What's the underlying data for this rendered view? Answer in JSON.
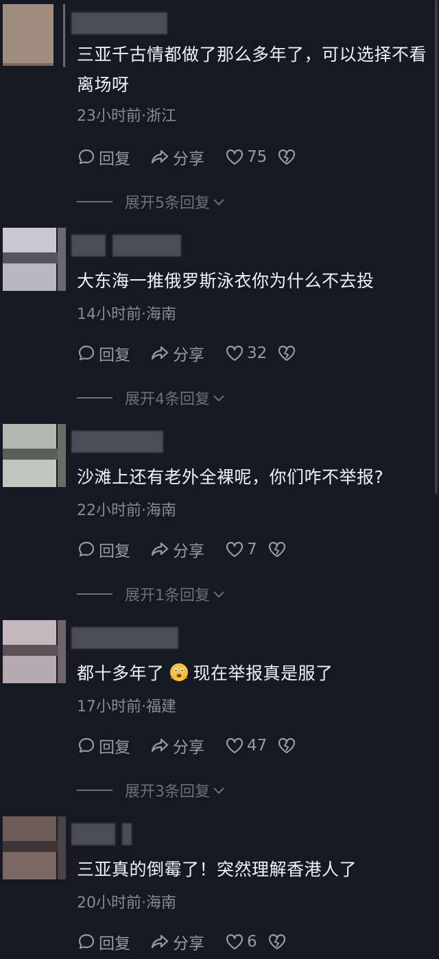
{
  "colors": {
    "background": "#161823",
    "text": "#f2f2f4",
    "meta": "#8a8b91",
    "action": "#9a9ba1",
    "expand": "#6f7077"
  },
  "actions": {
    "reply_label": "回复",
    "share_label": "分享"
  },
  "icons": [
    "comment-bubble-icon",
    "share-arrow-icon",
    "heart-icon",
    "broken-heart-icon",
    "chevron-down-icon",
    "scared-face-emoji"
  ],
  "comments": [
    {
      "text": "三亚千古情都做了那么多年了，可以选择不看离场呀",
      "meta": "23小时前·浙江",
      "likes": "75",
      "expand": "展开5条回复",
      "avatar_colors": [
        "#a18d80",
        "#7a6a60",
        "#b39a8d"
      ]
    },
    {
      "text": "大东海一推俄罗斯泳衣你为什么不去投",
      "meta": "14小时前·海南",
      "likes": "32",
      "expand": "展开4条回复",
      "avatar_colors": [
        "#c9c7cf",
        "#55535c",
        "#b9b7bf"
      ]
    },
    {
      "text": "沙滩上还有老外全裸呢，你们咋不举报?",
      "meta": "22小时前·海南",
      "likes": "7",
      "expand": "展开1条回复",
      "avatar_colors": [
        "#b4b6b0",
        "#5c5e59",
        "#c3c5bf"
      ]
    },
    {
      "text_before": "都十多年了",
      "text_after": "现在举报真是服了",
      "meta": "17小时前·福建",
      "likes": "47",
      "expand": "展开3条回复",
      "avatar_colors": [
        "#c4b8bd",
        "#5a5258",
        "#b6a8af"
      ]
    },
    {
      "text": "三亚真的倒霉了！突然理解香港人了",
      "meta": "20小时前·海南",
      "likes": "6",
      "avatar_colors": [
        "#6e5c58",
        "#3c3436",
        "#7b6763"
      ]
    }
  ]
}
